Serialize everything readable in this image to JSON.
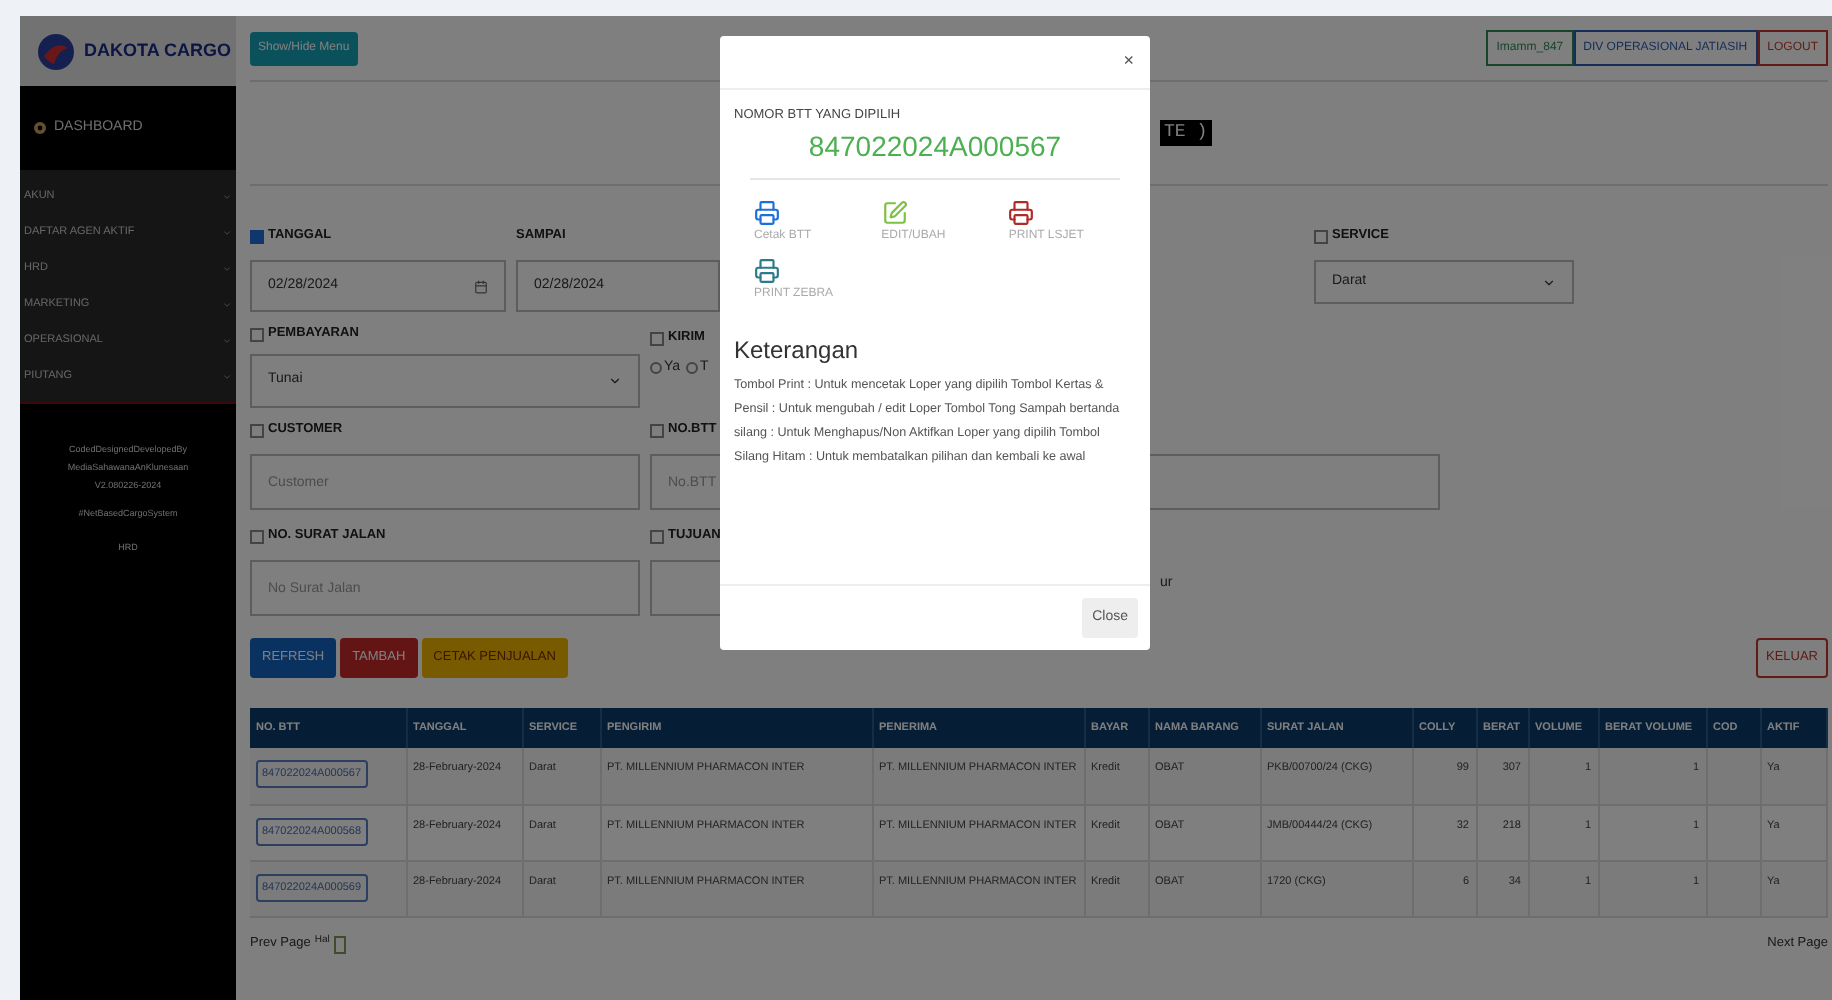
{
  "sidebar": {
    "logo": "DAKOTA CARGO",
    "dashboard": "DASHBOARD",
    "menu": [
      "AKUN",
      "DAFTAR AGEN AKTIF",
      "HRD",
      "MARKETING",
      "OPERASIONAL",
      "PIUTANG"
    ],
    "footer": [
      "CodedDesignedDevelopedBy",
      "MediaSahawanaAnKlunesaan",
      "V2.080226-2024",
      "#NetBasedCargoSystem",
      "HRD"
    ]
  },
  "header": {
    "toggle_button": "Show/Hide Menu",
    "badges": [
      {
        "text": "Imamm_847",
        "kind": "user"
      },
      {
        "text": "DIV OPERASIONAL JATIASIH",
        "kind": "division"
      },
      {
        "text": "LOGOUT",
        "kind": "logout"
      }
    ]
  },
  "page_title": "TE )",
  "form": {
    "tanggal": {
      "label": "TANGGAL",
      "checked": true,
      "value": "02/28/2024"
    },
    "sampai": {
      "label": "SAMPAI",
      "value": "02/28/2024"
    },
    "service": {
      "label": "SERVICE",
      "checked": false,
      "value": "Darat"
    },
    "pembayaran": {
      "label": "PEMBAYARAN",
      "checked": false,
      "value": "Tunai"
    },
    "kirim": {
      "label": "KIRIM",
      "checked": false,
      "options": [
        {
          "label": "Ya",
          "selected": false
        },
        {
          "label": "T",
          "selected": false
        }
      ]
    },
    "customer": {
      "label": "CUSTOMER",
      "checked": false,
      "placeholder": "Customer"
    },
    "no_btt": {
      "label": "NO.BTT",
      "checked": false,
      "placeholder": "No.BTT"
    },
    "no_surat_jalan": {
      "label": "NO. SURAT JALAN",
      "checked": false,
      "placeholder": "No Surat Jalan"
    },
    "tujuan": {
      "label": "TUJUAN",
      "checked": false
    },
    "column_4_label": "ur"
  },
  "buttons": [
    {
      "label": "REFRESH",
      "kind": "primary"
    },
    {
      "label": "TAMBAH",
      "kind": "danger"
    },
    {
      "label": "CETAK PENJUALAN",
      "kind": "warning"
    }
  ],
  "exit_button": "KELUAR",
  "table": {
    "columns": [
      "NO. BTT",
      "TANGGAL",
      "SERVICE",
      "PENGIRIM",
      "PENERIMA",
      "BAYAR",
      "NAMA BARANG",
      "SURAT JALAN",
      "COLLY",
      "BERAT",
      "VOLUME",
      "BERAT VOLUME",
      "COD",
      "AKTIF"
    ],
    "rows": [
      [
        "847022024A000567",
        "28-February-2024",
        "Darat",
        "PT. MILLENNIUM PHARMACON INTER",
        "PT. MILLENNIUM PHARMACON INTER",
        "Kredit",
        "OBAT",
        "PKB/00700/24 (CKG)",
        "99",
        "307",
        "1",
        "1",
        "",
        "Ya"
      ],
      [
        "847022024A000568",
        "28-February-2024",
        "Darat",
        "PT. MILLENNIUM PHARMACON INTER",
        "PT. MILLENNIUM PHARMACON INTER",
        "Kredit",
        "OBAT",
        "JMB/00444/24 (CKG)",
        "32",
        "218",
        "1",
        "1",
        "",
        "Ya"
      ],
      [
        "847022024A000569",
        "28-February-2024",
        "Darat",
        "PT. MILLENNIUM PHARMACON INTER",
        "PT. MILLENNIUM PHARMACON INTER",
        "Kredit",
        "OBAT",
        "1720 (CKG)",
        "6",
        "34",
        "1",
        "1",
        "",
        "Ya"
      ]
    ]
  },
  "pagination": {
    "prev": "Prev Page",
    "page_label": "Hal",
    "next": "Next Page"
  },
  "modal": {
    "close_icon": "×",
    "caption": "NOMOR BTT YANG DIPILIH",
    "number": "847022024A000567",
    "actions": [
      {
        "label": "Cetak BTT",
        "kind": "print"
      },
      {
        "label": "EDIT/UBAH",
        "kind": "edit"
      },
      {
        "label": "PRINT LSJET",
        "kind": "lsjet"
      },
      {
        "label": "PRINT ZEBRA",
        "kind": "zebra"
      }
    ],
    "heading": "Keterangan",
    "description": "Tombol Print : Untuk mencetak Loper yang dipilih Tombol Kertas & Pensil : Untuk mengubah / edit Loper Tombol Tong Sampah bertanda silang : Untuk Menghapus/Non Aktifkan Loper yang dipilih Tombol Silang Hitam : Untuk membatalkan pilihan dan kembali ke awal",
    "close_button": "Close"
  }
}
